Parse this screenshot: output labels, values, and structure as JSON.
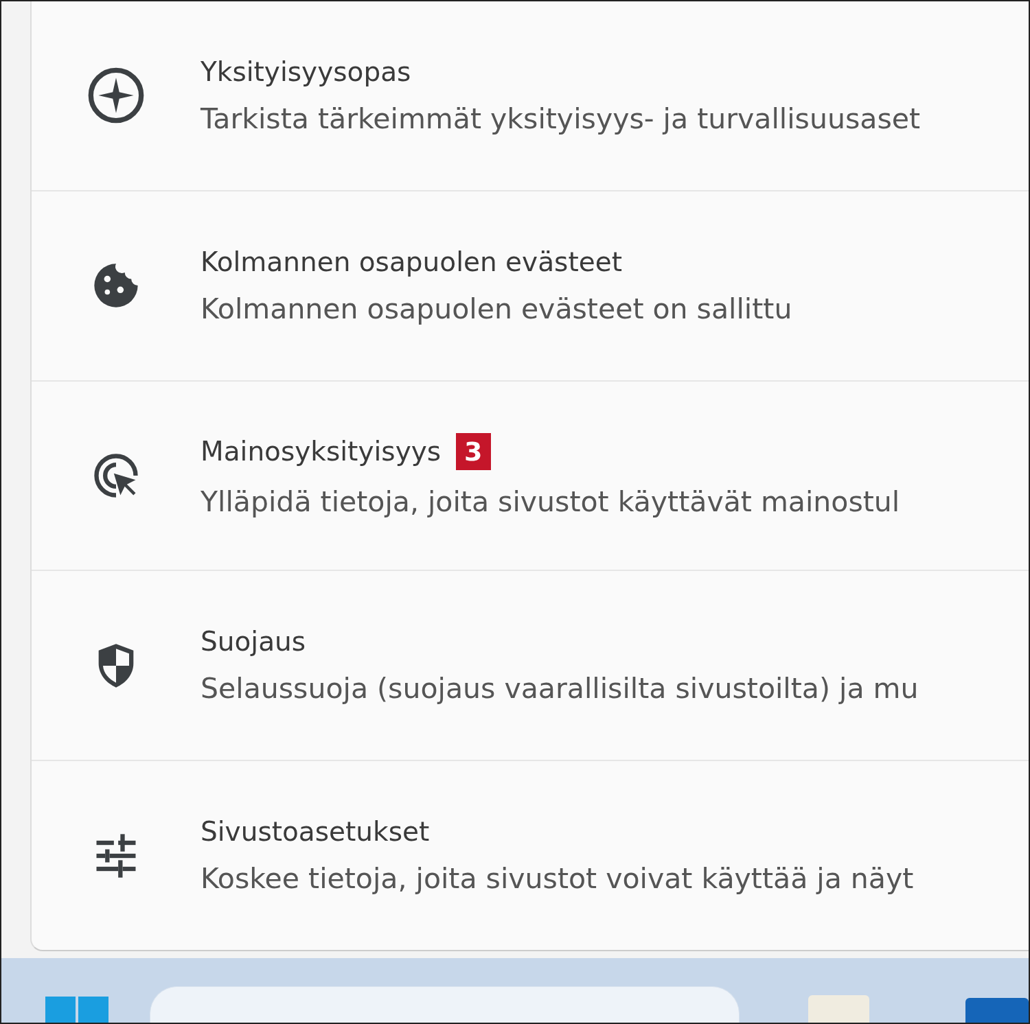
{
  "settings_items": [
    {
      "title": "Yksityisyysopas",
      "description": "Tarkista tärkeimmät yksityisyys- ja turvallisuusaset"
    },
    {
      "title": "Kolmannen osapuolen evästeet",
      "description": "Kolmannen osapuolen evästeet on sallittu"
    },
    {
      "title": "Mainosyksityisyys",
      "badge": "3",
      "description": "Ylläpidä tietoja, joita sivustot käyttävät mainostul"
    },
    {
      "title": "Suojaus",
      "description": "Selaussuoja (suojaus vaarallisilta sivustoilta) ja mu"
    },
    {
      "title": "Sivustoasetukset",
      "description": "Koskee tietoja, joita sivustot voivat käyttää ja näyt"
    }
  ],
  "taskbar": {
    "search": {
      "kind": "field"
    }
  }
}
